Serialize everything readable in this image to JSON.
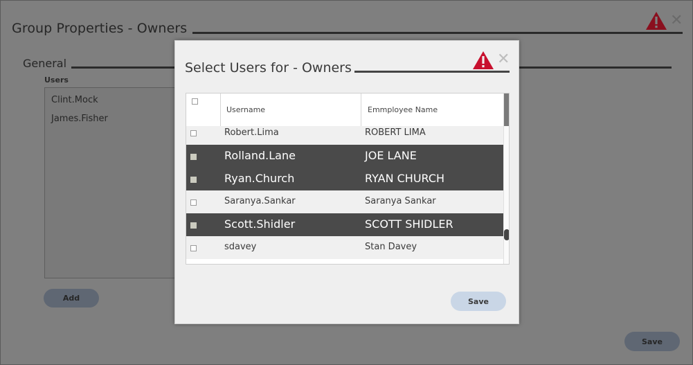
{
  "outer_dialog": {
    "title": "Group Properties - Owners",
    "section": "General",
    "users_label": "Users",
    "users": [
      "Clint.Mock",
      "James.Fisher"
    ],
    "add_label": "Add",
    "save_label": "Save",
    "close_glyph": "✕",
    "icons": [
      "warning-icon",
      "close-icon"
    ]
  },
  "inner_dialog": {
    "title": "Select Users for - Owners",
    "close_glyph": "✕",
    "columns": {
      "username": "Username",
      "employee_name": "Emmployee Name"
    },
    "rows": [
      {
        "username": "Robert.Lima",
        "employee": "ROBERT LIMA",
        "selected": false
      },
      {
        "username": "Rolland.Lane",
        "employee": "JOE LANE",
        "selected": true
      },
      {
        "username": "Ryan.Church",
        "employee": "RYAN CHURCH",
        "selected": true
      },
      {
        "username": "Saranya.Sankar",
        "employee": "Saranya Sankar",
        "selected": false
      },
      {
        "username": "Scott.Shidler",
        "employee": "SCOTT SHIDLER",
        "selected": true
      },
      {
        "username": "sdavey",
        "employee": "Stan Davey",
        "selected": false
      }
    ],
    "save_label": "Save"
  },
  "colors": {
    "warning_red": "#c8102e",
    "selected_row": "#4a4a4a",
    "save_button": "#c9d6e6"
  }
}
